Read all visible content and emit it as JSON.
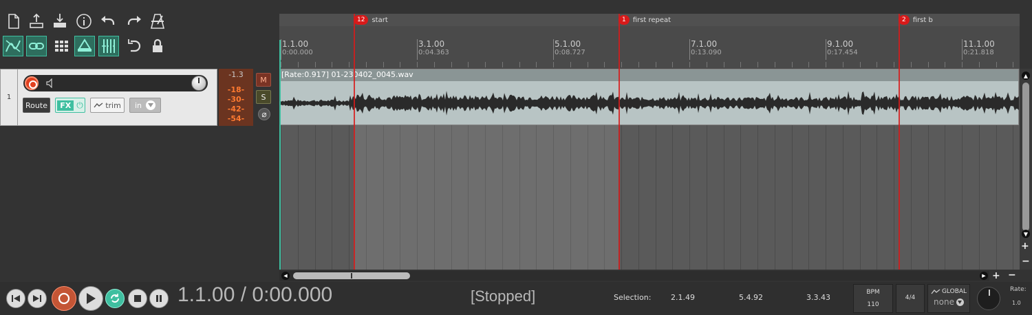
{
  "toolbar": {
    "icons": [
      "new-project-icon",
      "save-project-icon",
      "load-project-icon",
      "info-icon",
      "undo-icon",
      "redo-icon",
      "metronome-icon",
      "ripple-edit-icon",
      "snap-link-icon",
      "grid-icon",
      "item-grouping-icon",
      "grid-snap-icon",
      "loop-icon",
      "lock-icon"
    ]
  },
  "track": {
    "number": "1",
    "route_label": "Route",
    "fx_label": "FX",
    "trim_label": "trim",
    "input_label": "in",
    "peak": "-1.3",
    "meter_levels": [
      "-18-",
      "-30-",
      "-42-",
      "-54-"
    ],
    "mute_label": "M",
    "solo_label": "S",
    "phase_label": "⌀"
  },
  "markers": [
    {
      "id": "12",
      "name": "start"
    },
    {
      "id": "1",
      "name": "first repeat"
    },
    {
      "id": "2",
      "name": "first b"
    }
  ],
  "ruler": [
    {
      "bar": "1.1.00",
      "time": "0:00.000"
    },
    {
      "bar": "3.1.00",
      "time": "0:04.363"
    },
    {
      "bar": "5.1.00",
      "time": "0:08.727"
    },
    {
      "bar": "7.1.00",
      "time": "0:13.090"
    },
    {
      "bar": "9.1.00",
      "time": "0:17.454"
    },
    {
      "bar": "11.1.00",
      "time": "0:21.818"
    }
  ],
  "item": {
    "label": "[Rate:0.917] 01-230402_0045.wav"
  },
  "transport": {
    "time": "1.1.00 / 0:00.000",
    "status": "[Stopped]",
    "selection_label": "Selection:",
    "selection_start": "2.1.49",
    "selection_end": "5.4.92",
    "selection_length": "3.3.43",
    "bpm_label": "BPM",
    "bpm_value": "110",
    "time_signature": "4/4",
    "global_label": "GLOBAL",
    "global_value": "none",
    "rate_label": "Rate:",
    "rate_value": "1.0"
  },
  "colors": {
    "marker": "#d81a1a",
    "accent": "#3fbfa0",
    "record": "#e04020"
  }
}
